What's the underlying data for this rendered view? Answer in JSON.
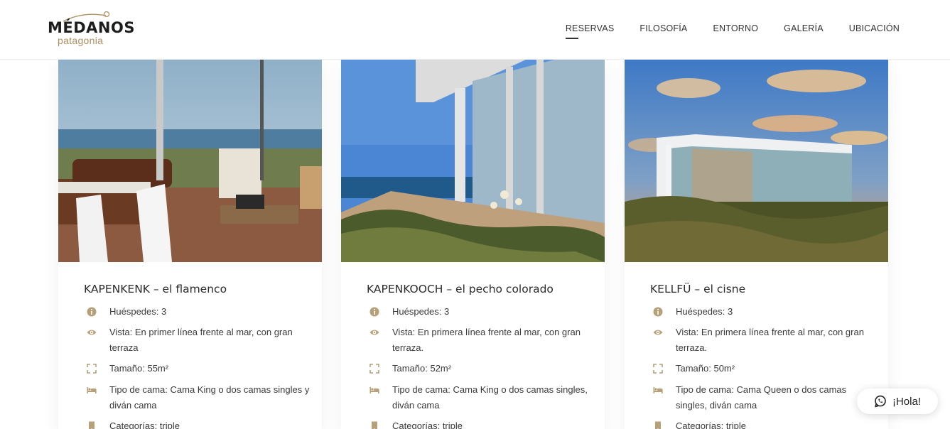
{
  "brand": {
    "name": "MÉDANOS",
    "sub": "patagonia",
    "accent": "#b08f5f"
  },
  "nav": [
    {
      "label": "RESERVAS",
      "active": true
    },
    {
      "label": "FILOSOFÍA"
    },
    {
      "label": "ENTORNO"
    },
    {
      "label": "GALERÍA"
    },
    {
      "label": "UBICACIÓN"
    }
  ],
  "cards": [
    {
      "title": "KAPENKENK – el flamenco",
      "guests": "Huéspedes: 3",
      "view": "Vista: En primer línea frente al mar, con gran terraza",
      "size": "Tamaño: 55m²",
      "bed": "Tipo de cama: Cama King o dos camas singles y diván cama",
      "category": "Categorías: triple"
    },
    {
      "title": "KAPENKOOCH – el pecho colorado",
      "guests": "Huéspedes: 3",
      "view": "Vista: En primera línea frente al mar, con gran terraza.",
      "size": "Tamaño: 52m²",
      "bed": "Tipo de cama: Cama King o dos camas singles, diván cama",
      "category": "Categorías: triple"
    },
    {
      "title": "KELLFÜ – el cisne",
      "guests": "Huéspedes: 3",
      "view": "Vista: En primera línea frente al mar, con gran terraza.",
      "size": "Tamaño: 50m²",
      "bed": "Tipo de cama: Cama Queen o dos camas singles, diván cama",
      "category": "Categorías: triple"
    }
  ],
  "chat": {
    "label": "¡Hola!"
  },
  "icons": {
    "color": "#b5a07a"
  }
}
